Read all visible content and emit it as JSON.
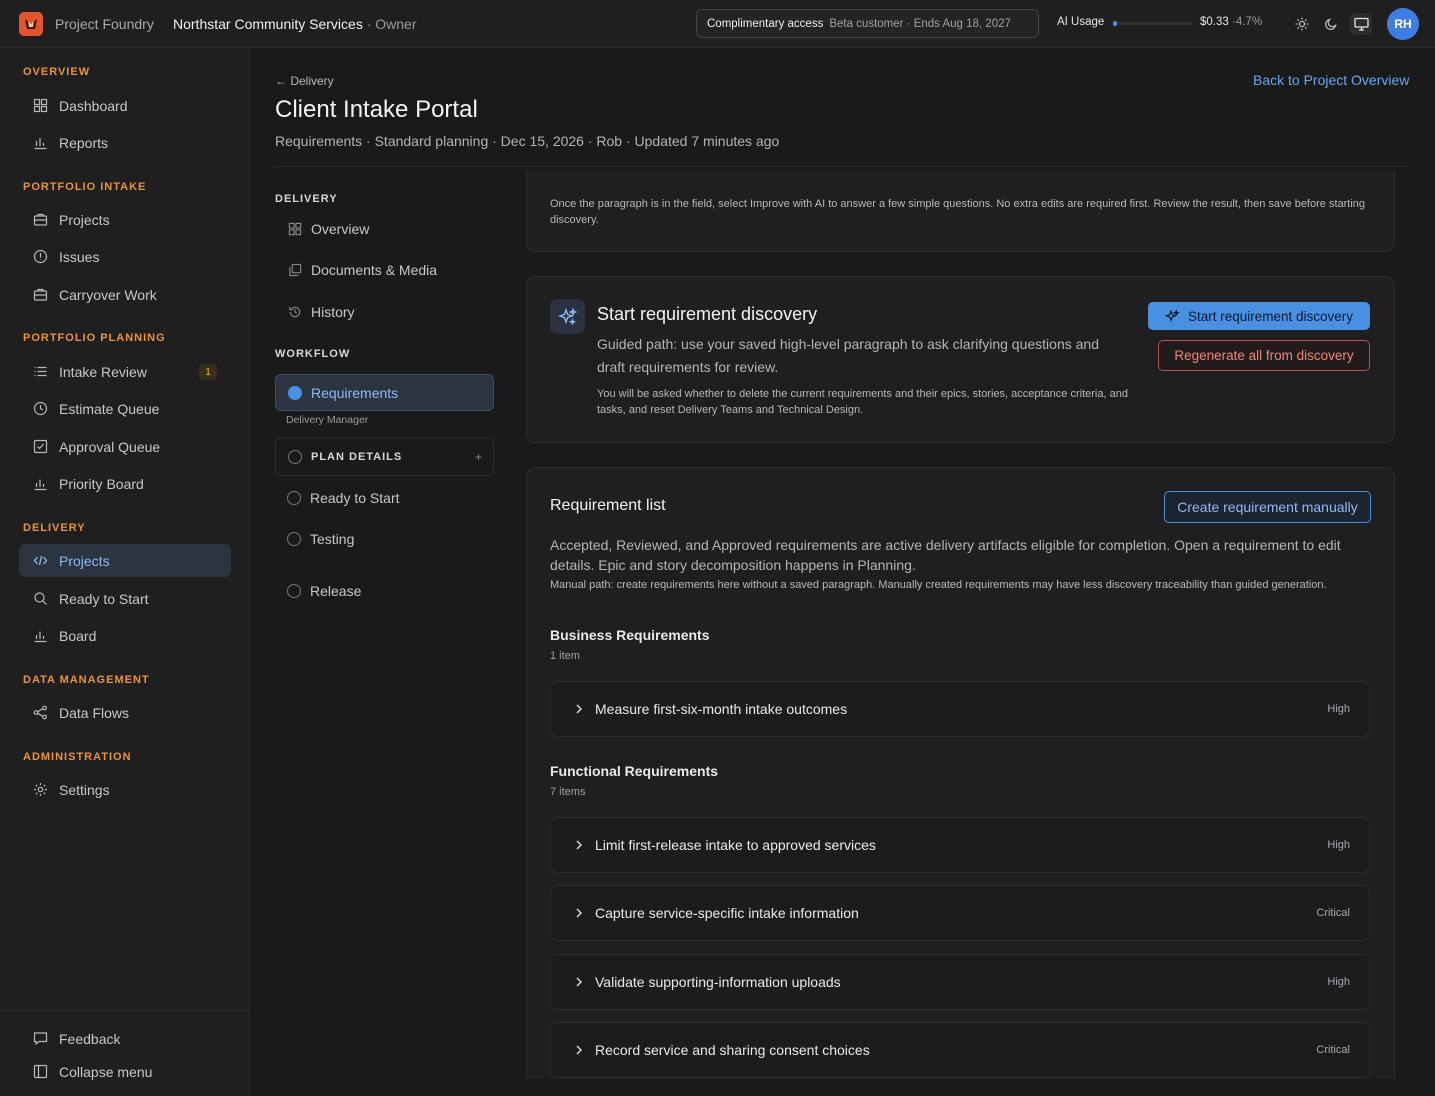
{
  "topbar": {
    "brand": "Project Foundry",
    "org": "Northstar Community Services",
    "role": "· Owner",
    "access_label": "Complimentary access",
    "access_detail": "Beta customer · Ends Aug 18, 2027",
    "ai_usage_label": "AI Usage",
    "ai_usage_fraction": 0.047,
    "ai_amount": "$0.33",
    "ai_percent": "4.7%",
    "avatar_initials": "RH"
  },
  "sidebar": {
    "sections": [
      {
        "label": "OVERVIEW",
        "items": [
          {
            "label": "Dashboard",
            "icon": "grid-icon"
          },
          {
            "label": "Reports",
            "icon": "bar-chart-icon"
          }
        ]
      },
      {
        "label": "PORTFOLIO INTAKE",
        "items": [
          {
            "label": "Projects",
            "icon": "briefcase-icon"
          },
          {
            "label": "Issues",
            "icon": "info-circle-icon"
          },
          {
            "label": "Carryover Work",
            "icon": "briefcase-icon"
          }
        ]
      },
      {
        "label": "PORTFOLIO PLANNING",
        "items": [
          {
            "label": "Intake Review",
            "icon": "list-icon",
            "badge": "1"
          },
          {
            "label": "Estimate Queue",
            "icon": "clock-icon"
          },
          {
            "label": "Approval Queue",
            "icon": "checkbox-icon"
          },
          {
            "label": "Priority Board",
            "icon": "bar-chart-icon"
          }
        ]
      },
      {
        "label": "DELIVERY",
        "items": [
          {
            "label": "Projects",
            "icon": "code-icon",
            "active": true
          },
          {
            "label": "Ready to Start",
            "icon": "search-icon"
          },
          {
            "label": "Board",
            "icon": "bar-chart-icon"
          }
        ]
      },
      {
        "label": "DATA MANAGEMENT",
        "items": [
          {
            "label": "Data Flows",
            "icon": "flow-icon"
          }
        ]
      },
      {
        "label": "ADMINISTRATION",
        "items": [
          {
            "label": "Settings",
            "icon": "gear-icon"
          }
        ]
      }
    ],
    "footer": {
      "feedback": "Feedback",
      "collapse": "Collapse menu"
    }
  },
  "header": {
    "breadcrumb": "← Delivery",
    "back_link": "Back to Project Overview",
    "title": "Client Intake Portal",
    "meta": "Requirements · Standard planning · Dec 15, 2026 · Rob · Updated 7 minutes ago"
  },
  "subnav": {
    "delivery_label": "DELIVERY",
    "delivery_items": [
      "Overview",
      "Documents & Media",
      "History"
    ],
    "workflow_label": "WORKFLOW",
    "active_item": "Requirements",
    "active_sub": "Delivery Manager",
    "plan_details": "PLAN DETAILS",
    "plan_plus": "+",
    "workflow_items": [
      "Ready to Start",
      "Testing",
      "Release"
    ]
  },
  "top_card": {
    "text": "Once the paragraph is in the field, select Improve with AI to answer a few simple questions. No extra edits are required first. Review the result, then save before starting discovery."
  },
  "discovery": {
    "title": "Start requirement discovery",
    "description": "Guided path: use your saved high-level paragraph to ask clarifying questions and draft requirements for review.",
    "warning": "You will be asked whether to delete the current requirements and their epics, stories, acceptance criteria, and tasks, and reset Delivery Teams and Technical Design.",
    "primary_button": "Start requirement discovery",
    "danger_button": "Regenerate all from discovery"
  },
  "requirements": {
    "title": "Requirement list",
    "create_button": "Create requirement manually",
    "description": "Accepted, Reviewed, and Approved requirements are active delivery artifacts eligible for completion. Open a requirement to edit details. Epic and story decomposition happens in Planning.",
    "manual_note": "Manual path: create requirements here without a saved paragraph. Manually created requirements may have less discovery traceability than guided generation.",
    "business": {
      "title": "Business Requirements",
      "count": "1 item",
      "rows": [
        {
          "label": "Measure first-six-month intake outcomes",
          "priority": "High"
        }
      ]
    },
    "functional": {
      "title": "Functional Requirements",
      "count": "7 items",
      "rows": [
        {
          "label": "Limit first-release intake to approved services",
          "priority": "High"
        },
        {
          "label": "Capture service-specific intake information",
          "priority": "Critical"
        },
        {
          "label": "Validate supporting-information uploads",
          "priority": "High"
        },
        {
          "label": "Record service and sharing consent choices",
          "priority": "Critical"
        }
      ]
    }
  },
  "colors": {
    "accent": "#4a90e2",
    "section": "#e8943a",
    "danger": "#ef8676"
  }
}
